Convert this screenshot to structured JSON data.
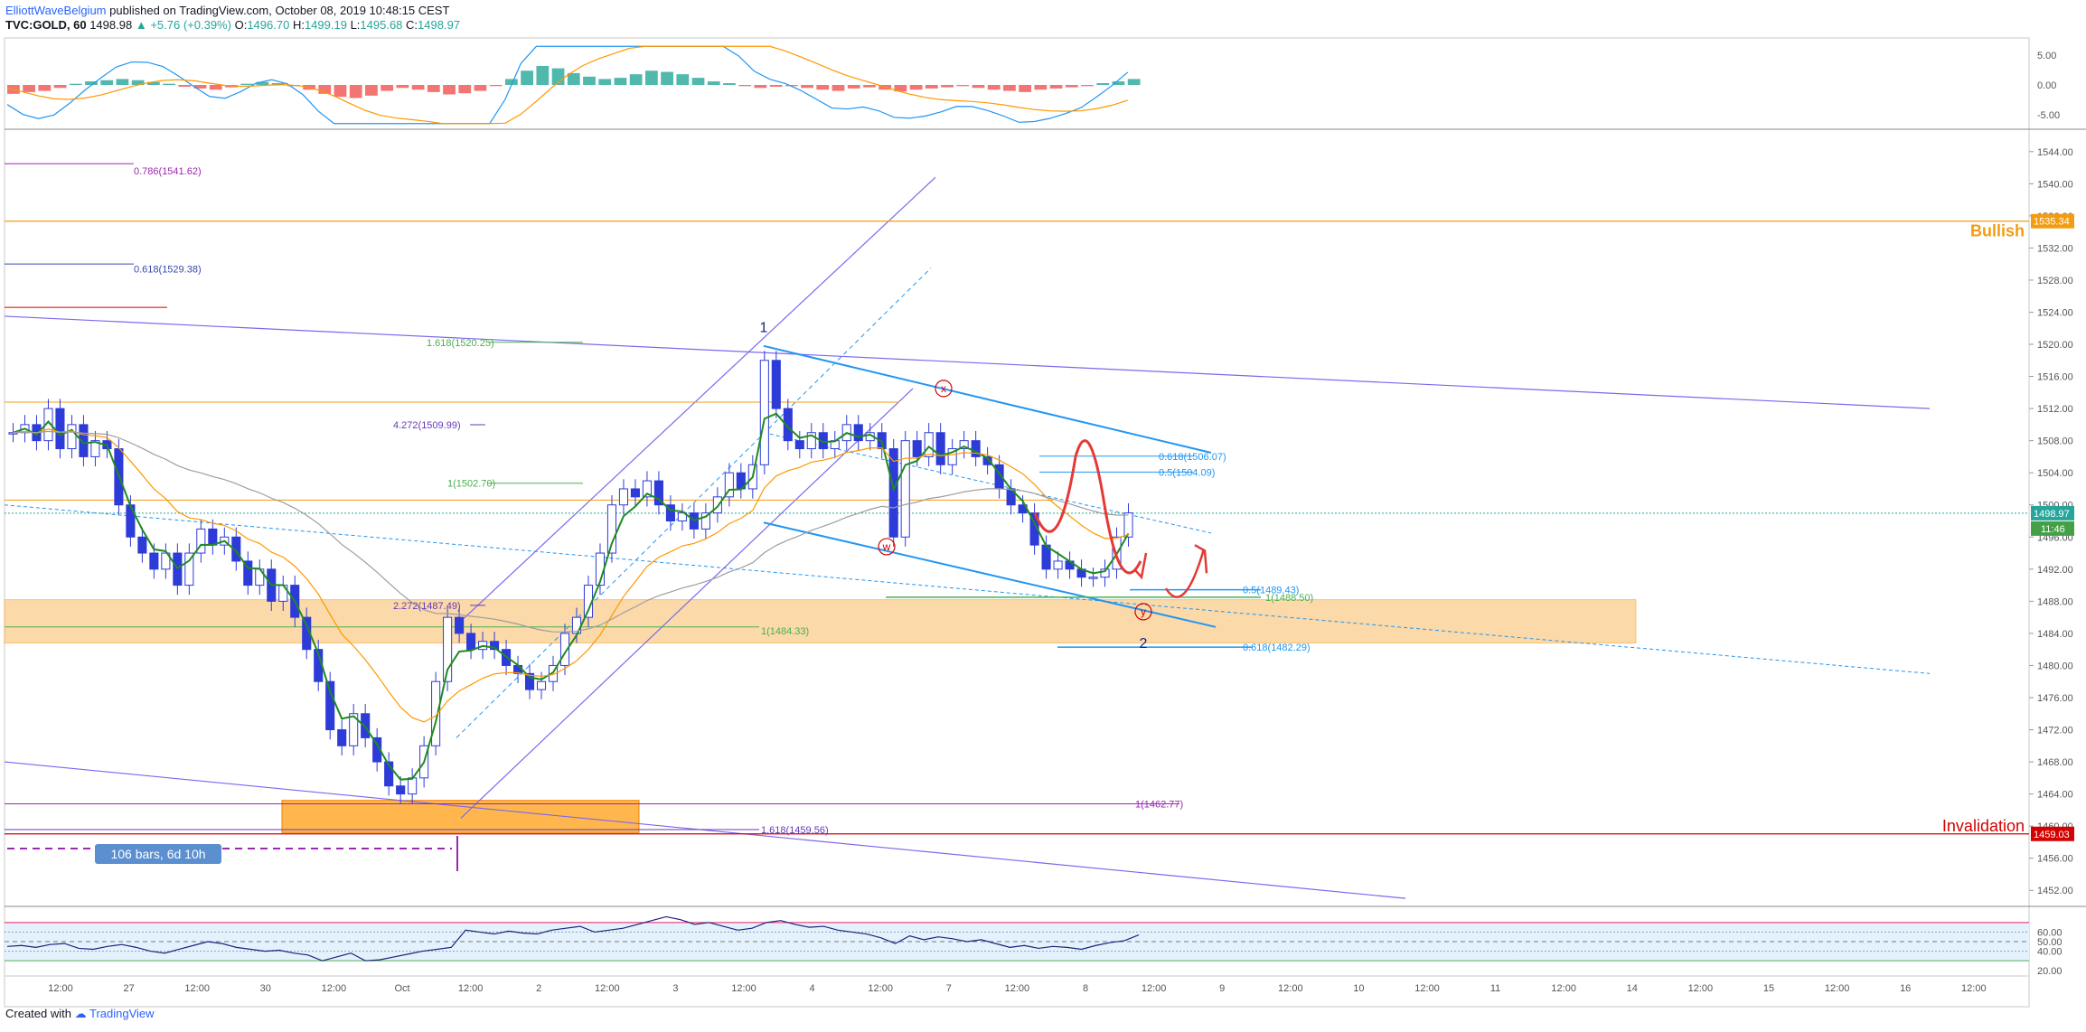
{
  "header": {
    "author": "ElliottWaveBelgium",
    "published": "published on TradingView.com, October 08, 2019 10:48:15 CEST",
    "symbol": "TVC:GOLD, 60",
    "price": "1498.98",
    "change": "+5.76 (+0.39%)",
    "o_label": "O:",
    "o": "1496.70",
    "h_label": "H:",
    "h": "1499.19",
    "l_label": "L:",
    "l": "1495.68",
    "c_label": "C:",
    "c": "1498.97"
  },
  "footer": {
    "created": "Created with",
    "brand": "TradingView"
  },
  "colors": {
    "up": "#2d3bd8",
    "down": "#2d3bd8",
    "ema_fast": "#1f8a1f",
    "ema_slow": "#ff9800",
    "sma": "#9e9e9e",
    "bullish": "#f39c12",
    "invalidation": "#d50000",
    "channel": "#7b68ee",
    "fib_blue": "#2196f3",
    "zone": "#fbd9a9"
  },
  "chart_data": [
    {
      "type": "candlestick",
      "title": "",
      "ylim": [
        1450,
        1546
      ],
      "yticks": [
        "1544.00",
        "1540.00",
        "1536.00",
        "1532.00",
        "1528.00",
        "1524.00",
        "1520.00",
        "1516.00",
        "1512.00",
        "1508.00",
        "1504.00",
        "1500.00",
        "1496.00",
        "1492.00",
        "1488.00",
        "1484.00",
        "1480.00",
        "1476.00",
        "1472.00",
        "1468.00",
        "1464.00",
        "1460.00",
        "1456.00",
        "1452.00"
      ],
      "xticks": [
        "12:00",
        "27",
        "12:00",
        "30",
        "12:00",
        "Oct",
        "12:00",
        "2",
        "12:00",
        "3",
        "12:00",
        "4",
        "12:00",
        "7",
        "12:00",
        "8",
        "12:00",
        "9",
        "12:00",
        "10",
        "12:00",
        "11",
        "12:00",
        "14",
        "12:00",
        "15",
        "12:00",
        "16",
        "12:00"
      ],
      "last_price": "1498.97",
      "countdown": "11:46",
      "price_labels": [
        {
          "text": "1535.34",
          "color": "#f39c12"
        },
        {
          "text": "1459.03",
          "color": "#d50000"
        }
      ],
      "close_path": [
        1509,
        1510,
        1508,
        1512,
        1507,
        1510,
        1506,
        1508,
        1507,
        1500,
        1496,
        1494,
        1492,
        1494,
        1490,
        1494,
        1497,
        1495,
        1496,
        1493,
        1490,
        1492,
        1488,
        1490,
        1486,
        1482,
        1478,
        1472,
        1470,
        1474,
        1471,
        1468,
        1465,
        1464,
        1466,
        1470,
        1478,
        1486,
        1484,
        1482,
        1483,
        1482,
        1480,
        1479,
        1477,
        1478,
        1480,
        1484,
        1486,
        1490,
        1494,
        1500,
        1502,
        1501,
        1503,
        1500,
        1498,
        1499,
        1497,
        1499,
        1501,
        1504,
        1502,
        1505,
        1518,
        1512,
        1508,
        1507,
        1509,
        1507,
        1508,
        1510,
        1508,
        1509,
        1507,
        1496,
        1508,
        1506,
        1509,
        1505,
        1507,
        1508,
        1506,
        1505,
        1502,
        1500,
        1499,
        1495,
        1492,
        1493,
        1492,
        1491,
        1491,
        1492,
        1496,
        1499
      ],
      "annotations": {
        "wave_1": "1",
        "wave_2": "2",
        "w": "w",
        "x": "x",
        "y": "y",
        "bullish": "Bullish",
        "invalidation": "Invalidation",
        "bars_label": "106 bars, 6d 10h",
        "fib_labels": [
          "0.786(1541.62)",
          "0.618(1529.38)",
          "1.618(1520.25)",
          "4.272(1509.99)",
          "1(1502.70)",
          "2.272(1487.49)",
          "1(1484.33)",
          "0.618(1506.07)",
          "0.5(1504.09)",
          "0.5(1489.43)",
          "1(1488.50)",
          "0.618(1482.29)",
          "1(1462.77)",
          "1.618(1459.56)"
        ]
      }
    },
    {
      "type": "bar",
      "title": "",
      "ylim": [
        -7,
        7
      ],
      "yticks": [
        "5.00",
        "0.00",
        "-5.00"
      ],
      "histogram": [
        -1.5,
        -1.2,
        -1,
        -0.5,
        0.2,
        0.6,
        0.8,
        1,
        0.8,
        0.5,
        0.2,
        -0.3,
        -0.6,
        -0.8,
        -0.4,
        0.2,
        0.5,
        0.3,
        -0.2,
        -0.8,
        -1.5,
        -2,
        -2.2,
        -1.8,
        -1,
        -0.5,
        -0.8,
        -1.2,
        -1.6,
        -1.4,
        -1,
        -0.2,
        1,
        2.4,
        3.2,
        2.8,
        2,
        1.4,
        1,
        1.2,
        1.8,
        2.4,
        2.2,
        1.8,
        1.2,
        0.6,
        0.3,
        -0.2,
        -0.5,
        -0.3,
        -0.2,
        -0.5,
        -0.8,
        -1,
        -0.6,
        -0.4,
        -0.8,
        -1.1,
        -0.8,
        -0.6,
        -0.4,
        -0.2,
        -0.5,
        -0.8,
        -1,
        -1.2,
        -0.8,
        -0.6,
        -0.4,
        -0.2,
        0.3,
        0.6,
        1
      ]
    },
    {
      "type": "line",
      "title": "",
      "ylim": [
        16,
        84
      ],
      "yticks": [
        "60.00",
        "50.00",
        "40.00",
        "20.00"
      ],
      "values": [
        45,
        46,
        44,
        47,
        48,
        43,
        42,
        45,
        47,
        44,
        40,
        38,
        42,
        46,
        50,
        48,
        44,
        42,
        40,
        41,
        38,
        36,
        30,
        34,
        38,
        30,
        31,
        34,
        37,
        40,
        42,
        44,
        62,
        60,
        58,
        61,
        59,
        58,
        62,
        64,
        66,
        60,
        62,
        64,
        68,
        72,
        76,
        73,
        68,
        70,
        66,
        62,
        64,
        70,
        72,
        68,
        65,
        66,
        62,
        60,
        58,
        54,
        48,
        56,
        52,
        55,
        53,
        50,
        52,
        48,
        44,
        46,
        43,
        45,
        44,
        42,
        46,
        49,
        51,
        57
      ]
    }
  ]
}
